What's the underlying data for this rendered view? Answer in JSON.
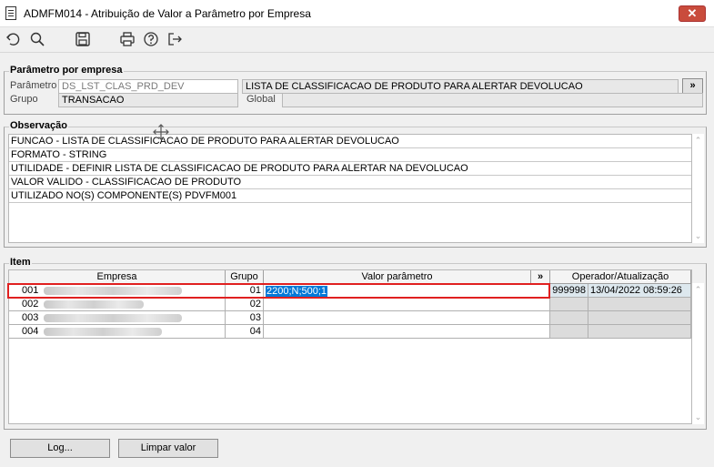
{
  "window": {
    "title": "ADMFM014 - Atribuição de Valor a Parâmetro por Empresa",
    "close_label": "✕"
  },
  "toolbar": {
    "icons": [
      "undo-icon",
      "search-icon",
      "save-icon",
      "print-icon",
      "help-icon",
      "exit-icon"
    ]
  },
  "param": {
    "legend": "Parâmetro por empresa",
    "parametro_label": "Parâmetro",
    "parametro_value": "DS_LST_CLAS_PRD_DEV",
    "description": "LISTA DE CLASSIFICACAO DE PRODUTO PARA ALERTAR DEVOLUCAO",
    "expand_label": "»",
    "grupo_label": "Grupo",
    "grupo_value": "TRANSACAO",
    "global_label": "Global",
    "global_value": ""
  },
  "observacao": {
    "legend": "Observação",
    "lines": [
      "FUNCAO - LISTA DE CLASSIFICACAO DE PRODUTO PARA ALERTAR DEVOLUCAO",
      "FORMATO - STRING",
      "UTILIDADE - DEFINIR LISTA DE CLASSIFICACAO DE PRODUTO PARA ALERTAR NA DEVOLUCAO",
      "VALOR VALIDO - CLASSIFICACAO DE PRODUTO",
      "UTILIZADO NO(S) COMPONENTE(S) PDVFM001"
    ]
  },
  "item": {
    "legend": "Item",
    "headers": {
      "empresa": "Empresa",
      "grupo": "Grupo",
      "valor": "Valor parâmetro",
      "expand": "»",
      "operador": "Operador/Atualização"
    },
    "rows": [
      {
        "empresa_code": "001",
        "grupo": "01",
        "valor": "2200;N;500;1",
        "operador": "999998",
        "atualizacao": "13/04/2022 08:59:26"
      },
      {
        "empresa_code": "002",
        "grupo": "02",
        "valor": "",
        "operador": "",
        "atualizacao": ""
      },
      {
        "empresa_code": "003",
        "grupo": "03",
        "valor": "",
        "operador": "",
        "atualizacao": ""
      },
      {
        "empresa_code": "004",
        "grupo": "04",
        "valor": "",
        "operador": "",
        "atualizacao": ""
      }
    ]
  },
  "buttons": {
    "log": "Log...",
    "limpar": "Limpar valor"
  },
  "colors": {
    "selection": "#0078d7",
    "highlight_border": "#e02020",
    "close": "#c94c3c"
  }
}
